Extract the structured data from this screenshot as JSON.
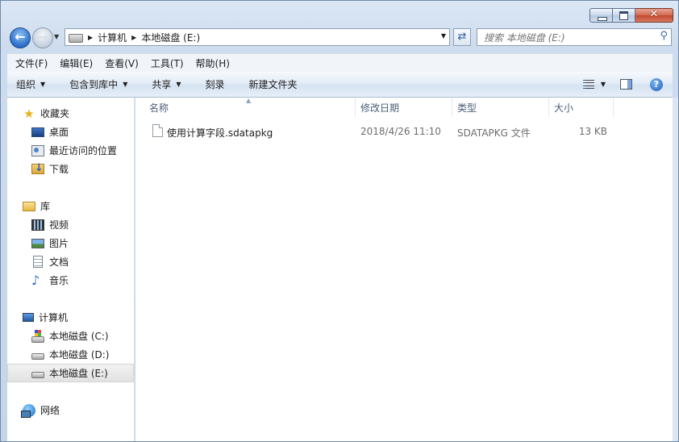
{
  "address": {
    "crumbs": [
      "计算机",
      "本地磁盘 (E:)"
    ]
  },
  "search": {
    "placeholder": "搜索 本地磁盘 (E:)"
  },
  "menu": [
    "文件(F)",
    "编辑(E)",
    "查看(V)",
    "工具(T)",
    "帮助(H)"
  ],
  "commands": {
    "organize": "组织",
    "include_in_library": "包含到库中",
    "share": "共享",
    "burn": "刻录",
    "new_folder": "新建文件夹"
  },
  "nav": {
    "favorites": "收藏夹",
    "desktop": "桌面",
    "recent": "最近访问的位置",
    "downloads": "下载",
    "libraries": "库",
    "videos": "视频",
    "pictures": "图片",
    "documents": "文档",
    "music": "音乐",
    "computer": "计算机",
    "drive_c": "本地磁盘 (C:)",
    "drive_d": "本地磁盘 (D:)",
    "drive_e": "本地磁盘 (E:)",
    "network": "网络"
  },
  "columns": {
    "name": "名称",
    "modified": "修改日期",
    "type": "类型",
    "size": "大小"
  },
  "files": [
    {
      "name": "使用计算字段.sdatapkg",
      "modified": "2018/4/26 11:10",
      "type": "SDATAPKG 文件",
      "size": "13 KB"
    }
  ]
}
